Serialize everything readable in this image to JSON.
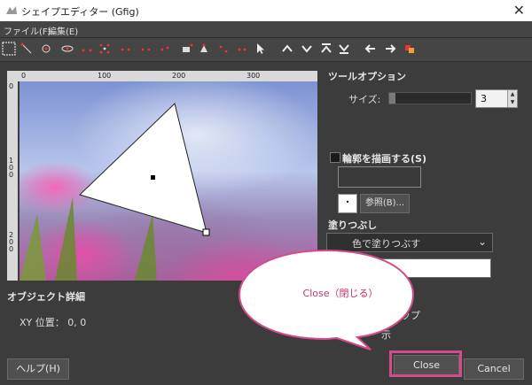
{
  "window": {
    "title": "シェイプエディター (Gfig)"
  },
  "menu": {
    "file": "ファイル(F)",
    "edit": "編集(E)"
  },
  "ruler": {
    "h_ticks": [
      "0",
      "100",
      "200",
      "300"
    ],
    "v_ticks": [
      "0",
      "1\n0\n0",
      "2\n0\n0"
    ]
  },
  "tool_options": {
    "title": "ツールオプション",
    "size_label": "サイズ:",
    "size_value": "3",
    "size_fraction": 0.08
  },
  "outline": {
    "label": "輪郭を描画する(S)",
    "ref_button": "参照(B)..."
  },
  "fill": {
    "title": "塗りつぶし",
    "mode_text": "色で塗りつぶす"
  },
  "object_details": {
    "title": "オブジェクト詳細",
    "xy_label": "XY 位置： 0, 0"
  },
  "partial_texts": {
    "snap_suffix": "ップ",
    "show_suffix": "示"
  },
  "buttons": {
    "help": "ヘルプ(H)",
    "close": "Close",
    "cancel": "Cancel"
  },
  "callout": {
    "text": "Close（閉じる）"
  },
  "colors": {
    "accent": "#d44a8a",
    "callout_text": "#c4316f",
    "bg": "#3c3c3c"
  }
}
